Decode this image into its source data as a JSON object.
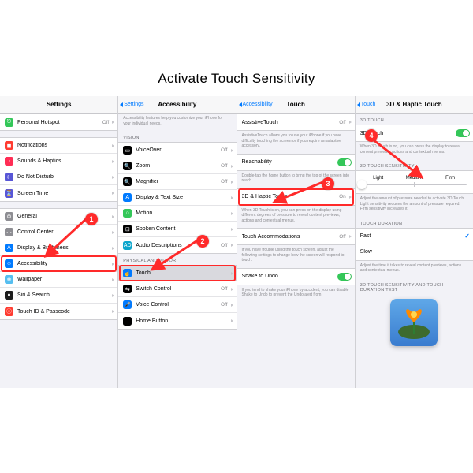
{
  "page": {
    "title": "Activate Touch Sensitivity"
  },
  "steps": {
    "1": "1",
    "2": "2",
    "3": "3",
    "4": "4"
  },
  "nav": {
    "settings": "Settings",
    "accessibility": "Accessibility",
    "touch": "Touch",
    "threed": "3D & Haptic Touch"
  },
  "values": {
    "off": "Off",
    "on": "On"
  },
  "screen1": {
    "items_a": [
      {
        "label": "Personal Hotspot",
        "value": "Off",
        "icon": "#34c759",
        "glyph": "⎋"
      }
    ],
    "items_b": [
      {
        "label": "Notifications",
        "icon": "#ff3b30",
        "glyph": "◼︎"
      },
      {
        "label": "Sounds & Haptics",
        "icon": "#ff2d55",
        "glyph": "♪"
      },
      {
        "label": "Do Not Disturb",
        "icon": "#5856d6",
        "glyph": "☾"
      },
      {
        "label": "Screen Time",
        "icon": "#5856d6",
        "glyph": "⏳"
      }
    ],
    "items_c": [
      {
        "label": "General",
        "icon": "#8e8e93",
        "glyph": "⚙"
      },
      {
        "label": "Control Center",
        "icon": "#8e8e93",
        "glyph": "⋯"
      },
      {
        "label": "Display & Brightness",
        "icon": "#007aff",
        "glyph": "A"
      },
      {
        "label": "Accessibility",
        "icon": "#007aff",
        "glyph": "☺",
        "highlight": true
      },
      {
        "label": "Wallpaper",
        "icon": "#55bef0",
        "glyph": "❀"
      },
      {
        "label": "Siri & Search",
        "icon": "#1e1e1e",
        "glyph": "●"
      },
      {
        "label": "Touch ID & Passcode",
        "icon": "#ff3b30",
        "glyph": "⦿"
      }
    ]
  },
  "screen2": {
    "intro": "Accessibility features help you customize your iPhone for your individual needs.",
    "vision_header": "VISION",
    "physical_header": "PHYSICAL AND MOTOR",
    "vision": [
      {
        "label": "VoiceOver",
        "value": "Off",
        "icon": "#000",
        "glyph": "▭"
      },
      {
        "label": "Zoom",
        "value": "Off",
        "icon": "#000",
        "glyph": "🔍"
      },
      {
        "label": "Magnifier",
        "value": "Off",
        "icon": "#000",
        "glyph": "🔍"
      },
      {
        "label": "Display & Text Size",
        "icon": "#007aff",
        "glyph": "A"
      },
      {
        "label": "Motion",
        "icon": "#34c759",
        "glyph": "○"
      },
      {
        "label": "Spoken Content",
        "icon": "#000",
        "glyph": "⊟"
      },
      {
        "label": "Audio Descriptions",
        "value": "Off",
        "icon": "#0da6cc",
        "glyph": "AD"
      }
    ],
    "physical": [
      {
        "label": "Touch",
        "icon": "#007aff",
        "glyph": "☝",
        "highlight": true,
        "selected": true
      },
      {
        "label": "Switch Control",
        "value": "Off",
        "icon": "#000",
        "glyph": "⇆"
      },
      {
        "label": "Voice Control",
        "value": "Off",
        "icon": "#007aff",
        "glyph": "🎤"
      },
      {
        "label": "Home Button",
        "icon": "#000"
      }
    ]
  },
  "screen3": {
    "assistive": {
      "label": "AssistiveTouch",
      "value": "Off",
      "footer": "AssistiveTouch allows you to use your iPhone if you have difficulty touching the screen or if you require an adaptive accessory."
    },
    "reachability": {
      "label": "Reachability",
      "on": true,
      "footer": "Double-tap the home button to bring the top of the screen into reach."
    },
    "threed": {
      "label": "3D & Haptic Touch",
      "value": "On",
      "footer": "When 3D Touch is on, you can press on the display using different degrees of pressure to reveal content previews, actions and contextual menus."
    },
    "accom": {
      "label": "Touch Accommodations",
      "value": "Off",
      "footer": "If you have trouble using the touch screen, adjust the following settings to change how the screen will respond to touch."
    },
    "shake": {
      "label": "Shake to Undo",
      "on": true,
      "footer": "If you tend to shake your iPhone by accident, you can disable Shake to Undo to prevent the Undo alert from"
    }
  },
  "screen4": {
    "s1_header": "3D TOUCH",
    "s1_label": "3D Touch",
    "s1_footer": "When 3D Touch is on, you can press the display to reveal content previews, actions and contextual menus.",
    "s2_header": "3D TOUCH SENSITIVITY",
    "seg": {
      "light": "Light",
      "medium": "Medium",
      "firm": "Firm"
    },
    "s2_footer": "Adjust the amount of pressure needed to activate 3D Touch. Light sensitivity reduces the amount of pressure required. Firm sensitivity increases it.",
    "s3_header": "TOUCH DURATION",
    "dur": {
      "fast": "Fast",
      "slow": "Slow"
    },
    "s3_footer": "Adjust the time it takes to reveal content previews, actions and contextual menus.",
    "s4_header": "3D TOUCH SENSITIVITY AND TOUCH DURATION TEST"
  }
}
